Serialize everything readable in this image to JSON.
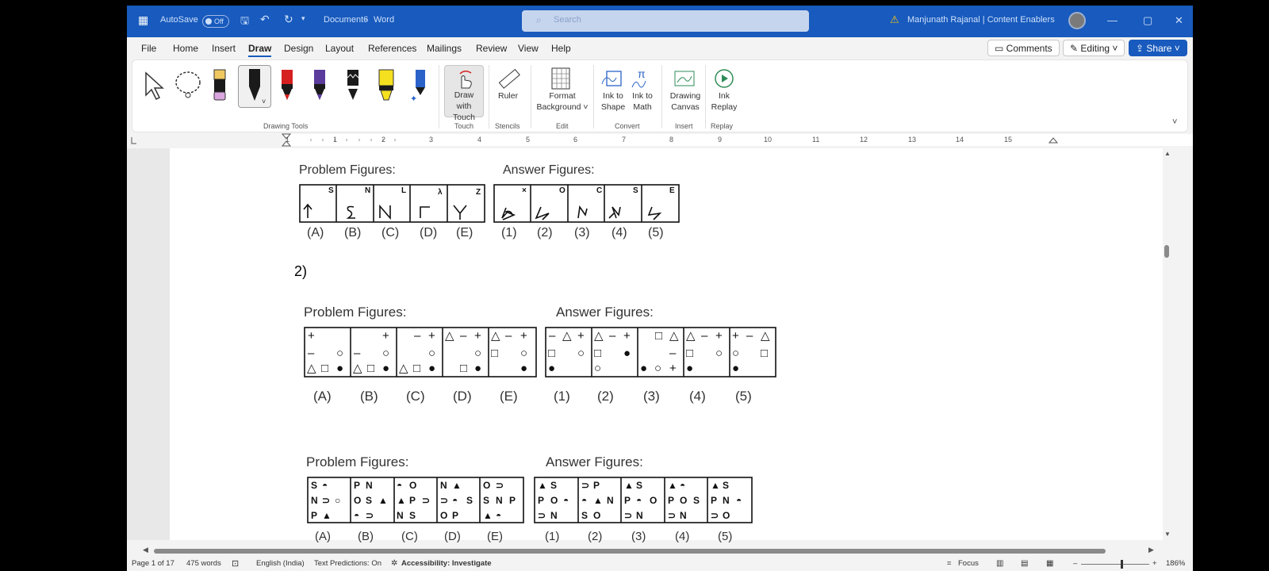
{
  "titlebar": {
    "autosave_label": "AutoSave",
    "autosave_state": "Off",
    "doc_name": "Document6",
    "app_name": "Word",
    "search_placeholder": "Search",
    "user": "Manjunath Rajanal | Content Enablers"
  },
  "menu": {
    "tabs": [
      "File",
      "Home",
      "Insert",
      "Draw",
      "Design",
      "Layout",
      "References",
      "Mailings",
      "Review",
      "View",
      "Help"
    ],
    "active": "Draw",
    "comments_label": "Comments",
    "editing_label": "Editing",
    "share_label": "Share"
  },
  "ribbon": {
    "drawing_tools_label": "Drawing Tools",
    "draw_with_touch": "Draw with Touch",
    "touch_group": "Touch",
    "ruler": "Ruler",
    "stencils_group": "Stencils",
    "format_background": "Format Background",
    "edit_group": "Edit",
    "ink_to_shape": "Ink to Shape",
    "ink_to_math": "Ink to Math",
    "convert_group": "Convert",
    "drawing_canvas": "Drawing Canvas",
    "insert_group": "Insert",
    "ink_replay": "Ink Replay",
    "replay_group": "Replay",
    "pen_colors": [
      "#e0e0e0",
      "#1a1a1a",
      "#d62020",
      "#5b3b9c",
      "#1a1a1a",
      "#f5e020",
      "#2a62c9"
    ]
  },
  "ruler": {
    "numbers": [
      "1",
      "1",
      "2",
      "3",
      "4",
      "5",
      "6",
      "7",
      "8",
      "9",
      "10",
      "11",
      "12",
      "13",
      "14",
      "15"
    ]
  },
  "document": {
    "q2_label": "2)",
    "block1": {
      "problem_title": "Problem Figures:",
      "answer_title": "Answer Figures:",
      "problem_labels": [
        "(A)",
        "(B)",
        "(C)",
        "(D)",
        "(E)"
      ],
      "answer_labels": [
        "(1)",
        "(2)",
        "(3)",
        "(4)",
        "(5)"
      ]
    },
    "block2": {
      "problem_title": "Problem Figures:",
      "answer_title": "Answer Figures:",
      "problem_labels": [
        "(A)",
        "(B)",
        "(C)",
        "(D)",
        "(E)"
      ],
      "answer_labels": [
        "(1)",
        "(2)",
        "(3)",
        "(4)",
        "(5)"
      ]
    },
    "block3": {
      "problem_title": "Problem Figures:",
      "answer_title": "Answer Figures:",
      "problem_labels": [
        "(A)",
        "(B)",
        "(C)",
        "(D)",
        "(E)"
      ],
      "answer_labels": [
        "(1)",
        "(2)",
        "(3)",
        "(4)",
        "(5)"
      ]
    }
  },
  "status": {
    "page": "Page 1 of 17",
    "words": "475 words",
    "language": "English (India)",
    "predictions": "Text Predictions: On",
    "accessibility": "Accessibility: Investigate",
    "focus": "Focus",
    "zoom": "186%"
  }
}
